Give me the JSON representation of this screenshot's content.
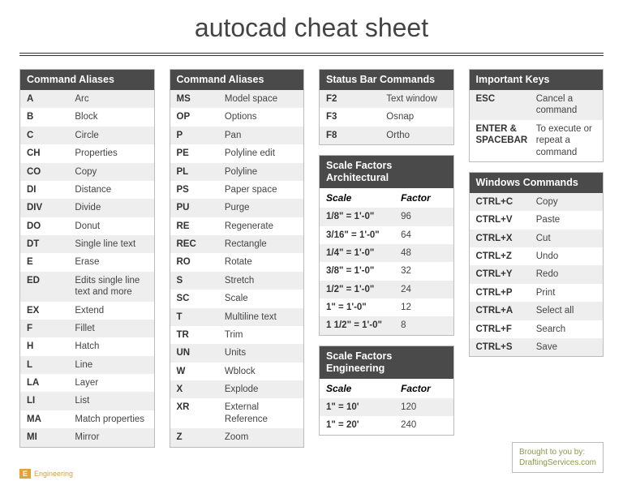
{
  "title": "autocad cheat sheet",
  "col1": {
    "header": "Command Aliases",
    "rows": [
      {
        "k": "A",
        "v": "Arc"
      },
      {
        "k": "B",
        "v": "Block"
      },
      {
        "k": "C",
        "v": "Circle"
      },
      {
        "k": "CH",
        "v": "Properties"
      },
      {
        "k": "CO",
        "v": "Copy"
      },
      {
        "k": "DI",
        "v": "Distance"
      },
      {
        "k": "DIV",
        "v": "Divide"
      },
      {
        "k": "DO",
        "v": "Donut"
      },
      {
        "k": "DT",
        "v": "Single line text"
      },
      {
        "k": "E",
        "v": "Erase"
      },
      {
        "k": "ED",
        "v": "Edits single line text and more"
      },
      {
        "k": "EX",
        "v": "Extend"
      },
      {
        "k": "F",
        "v": "Fillet"
      },
      {
        "k": "H",
        "v": "Hatch"
      },
      {
        "k": "L",
        "v": "Line"
      },
      {
        "k": "LA",
        "v": "Layer"
      },
      {
        "k": "LI",
        "v": "List"
      },
      {
        "k": "MA",
        "v": "Match properties"
      },
      {
        "k": "MI",
        "v": "Mirror"
      }
    ]
  },
  "col2": {
    "header": "Command Aliases",
    "rows": [
      {
        "k": "MS",
        "v": "Model space"
      },
      {
        "k": "OP",
        "v": "Options"
      },
      {
        "k": "P",
        "v": "Pan"
      },
      {
        "k": "PE",
        "v": "Polyline edit"
      },
      {
        "k": "PL",
        "v": "Polyline"
      },
      {
        "k": "PS",
        "v": "Paper space"
      },
      {
        "k": "PU",
        "v": "Purge"
      },
      {
        "k": "RE",
        "v": "Regenerate"
      },
      {
        "k": "REC",
        "v": "Rectangle"
      },
      {
        "k": "RO",
        "v": "Rotate"
      },
      {
        "k": "S",
        "v": "Stretch"
      },
      {
        "k": "SC",
        "v": "Scale"
      },
      {
        "k": "T",
        "v": "Multiline text"
      },
      {
        "k": "TR",
        "v": "Trim"
      },
      {
        "k": "UN",
        "v": "Units"
      },
      {
        "k": "W",
        "v": "Wblock"
      },
      {
        "k": "X",
        "v": "Explode"
      },
      {
        "k": "XR",
        "v": "External Reference"
      },
      {
        "k": "Z",
        "v": "Zoom"
      }
    ]
  },
  "status": {
    "header": "Status Bar Commands",
    "rows": [
      {
        "k": "F2",
        "v": "Text window"
      },
      {
        "k": "F3",
        "v": "Osnap"
      },
      {
        "k": "F8",
        "v": "Ortho"
      }
    ]
  },
  "scale_arch": {
    "header": "Scale Factors Architectural",
    "sub1": "Scale",
    "sub2": "Factor",
    "rows": [
      {
        "k": "1/8\" = 1'-0\"",
        "v": "96"
      },
      {
        "k": "3/16\" = 1'-0\"",
        "v": "64"
      },
      {
        "k": "1/4\" = 1'-0\"",
        "v": "48"
      },
      {
        "k": "3/8\" = 1'-0\"",
        "v": "32"
      },
      {
        "k": "1/2\" = 1'-0\"",
        "v": "24"
      },
      {
        "k": "1\" = 1'-0\"",
        "v": "12"
      },
      {
        "k": "1 1/2\" = 1'-0\"",
        "v": "8"
      }
    ]
  },
  "scale_eng": {
    "header": "Scale Factors Engineering",
    "sub1": "Scale",
    "sub2": "Factor",
    "rows": [
      {
        "k": "1\" = 10'",
        "v": "120"
      },
      {
        "k": "1\" = 20'",
        "v": "240"
      }
    ]
  },
  "important": {
    "header": "Important Keys",
    "rows": [
      {
        "k": "ESC",
        "v": "Cancel a command"
      },
      {
        "k": "ENTER & SPACEBAR",
        "v": "To execute or repeat a command"
      }
    ]
  },
  "windows": {
    "header": "Windows Commands",
    "rows": [
      {
        "k": "CTRL+C",
        "v": "Copy"
      },
      {
        "k": "CTRL+V",
        "v": "Paste"
      },
      {
        "k": "CTRL+X",
        "v": "Cut"
      },
      {
        "k": "CTRL+Z",
        "v": "Undo"
      },
      {
        "k": "CTRL+Y",
        "v": "Redo"
      },
      {
        "k": "CTRL+P",
        "v": "Print"
      },
      {
        "k": "CTRL+A",
        "v": "Select all"
      },
      {
        "k": "CTRL+F",
        "v": "Search"
      },
      {
        "k": "CTRL+S",
        "v": "Save"
      }
    ]
  },
  "credit_line1": "Brought to you by:",
  "credit_line2": "DraftingServices.com",
  "footer_badge": "E",
  "footer_text": "Engineering"
}
